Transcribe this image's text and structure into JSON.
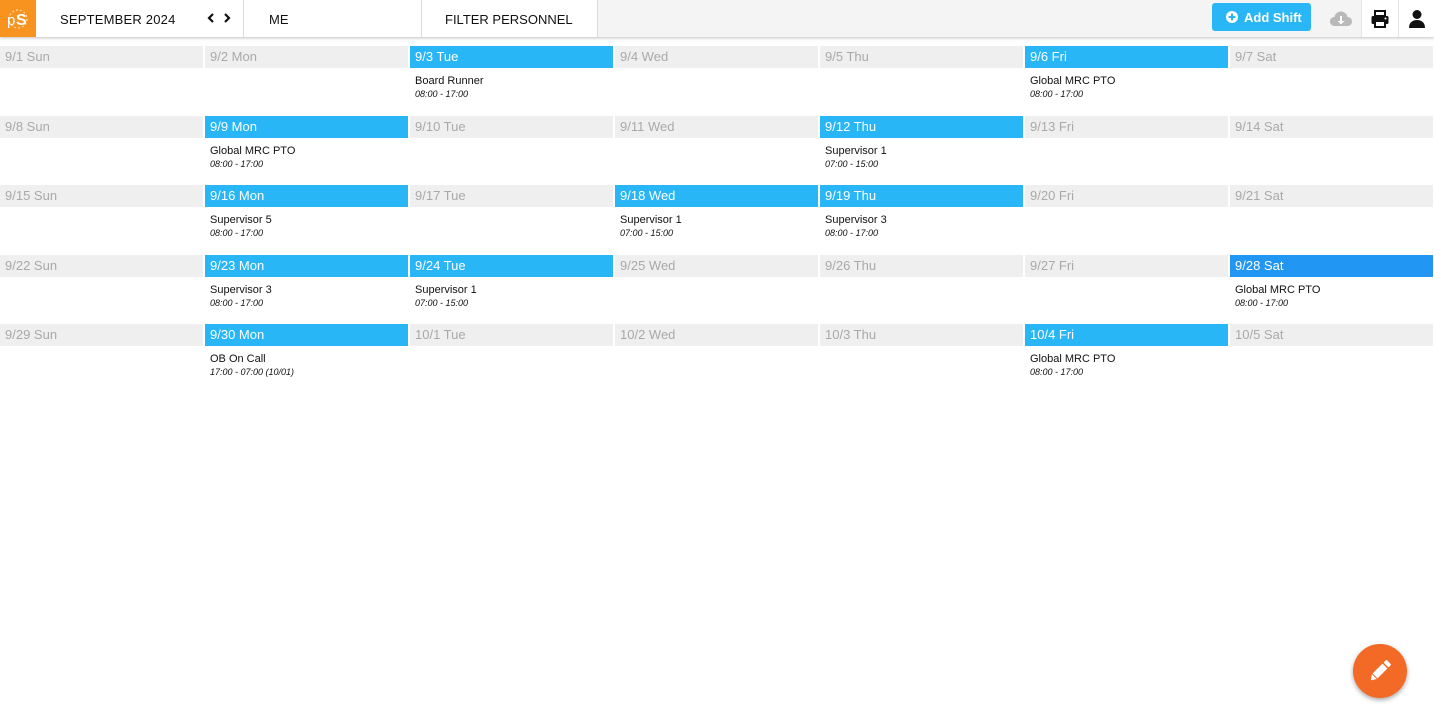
{
  "header": {
    "logo_text": "pS",
    "month_label": "SEPTEMBER 2024",
    "me_label": "ME",
    "filter_label": "FILTER PERSONNEL",
    "add_shift_label": "Add Shift",
    "icons": {
      "prev": "chevron-left-icon",
      "next": "chevron-right-icon",
      "add": "plus-circle-icon",
      "cloud": "cloud-download-icon",
      "print": "printer-icon",
      "user": "user-icon",
      "edit": "pencil-icon"
    }
  },
  "colors": {
    "brand_orange": "#f7931e",
    "accent_blue": "#29b6f6",
    "today_blue": "#2196f3",
    "fab_orange": "#f26a26",
    "inactive_header": "#efefef"
  },
  "weeks": [
    {
      "days": [
        {
          "label": "9/1 Sun",
          "shift": null
        },
        {
          "label": "9/2 Mon",
          "shift": null
        },
        {
          "label": "9/3 Tue",
          "shift": {
            "name": "Board Runner",
            "time": "08:00 - 17:00"
          }
        },
        {
          "label": "9/4 Wed",
          "shift": null
        },
        {
          "label": "9/5 Thu",
          "shift": null
        },
        {
          "label": "9/6 Fri",
          "shift": {
            "name": "Global MRC PTO",
            "time": "08:00 - 17:00"
          }
        },
        {
          "label": "9/7 Sat",
          "shift": null
        }
      ]
    },
    {
      "days": [
        {
          "label": "9/8 Sun",
          "shift": null
        },
        {
          "label": "9/9 Mon",
          "shift": {
            "name": "Global MRC PTO",
            "time": "08:00 - 17:00"
          }
        },
        {
          "label": "9/10 Tue",
          "shift": null
        },
        {
          "label": "9/11 Wed",
          "shift": null
        },
        {
          "label": "9/12 Thu",
          "shift": {
            "name": "Supervisor 1",
            "time": "07:00 - 15:00"
          }
        },
        {
          "label": "9/13 Fri",
          "shift": null
        },
        {
          "label": "9/14 Sat",
          "shift": null
        }
      ]
    },
    {
      "days": [
        {
          "label": "9/15 Sun",
          "shift": null
        },
        {
          "label": "9/16 Mon",
          "shift": {
            "name": "Supervisor 5",
            "time": "08:00 - 17:00"
          }
        },
        {
          "label": "9/17 Tue",
          "shift": null
        },
        {
          "label": "9/18 Wed",
          "shift": {
            "name": "Supervisor 1",
            "time": "07:00 - 15:00"
          }
        },
        {
          "label": "9/19 Thu",
          "shift": {
            "name": "Supervisor 3",
            "time": "08:00 - 17:00"
          }
        },
        {
          "label": "9/20 Fri",
          "shift": null
        },
        {
          "label": "9/21 Sat",
          "shift": null
        }
      ]
    },
    {
      "days": [
        {
          "label": "9/22 Sun",
          "shift": null
        },
        {
          "label": "9/23 Mon",
          "shift": {
            "name": "Supervisor 3",
            "time": "08:00 - 17:00"
          }
        },
        {
          "label": "9/24 Tue",
          "shift": {
            "name": "Supervisor 1",
            "time": "07:00 - 15:00"
          }
        },
        {
          "label": "9/25 Wed",
          "shift": null
        },
        {
          "label": "9/26 Thu",
          "shift": null
        },
        {
          "label": "9/27 Fri",
          "shift": null
        },
        {
          "label": "9/28 Sat",
          "shift": {
            "name": "Global MRC PTO",
            "time": "08:00 - 17:00"
          },
          "today": true
        }
      ]
    },
    {
      "days": [
        {
          "label": "9/29 Sun",
          "shift": null
        },
        {
          "label": "9/30 Mon",
          "shift": {
            "name": "OB On Call",
            "time": "17:00 - 07:00 (10/01)"
          }
        },
        {
          "label": "10/1 Tue",
          "shift": null
        },
        {
          "label": "10/2 Wed",
          "shift": null
        },
        {
          "label": "10/3 Thu",
          "shift": null
        },
        {
          "label": "10/4 Fri",
          "shift": {
            "name": "Global MRC PTO",
            "time": "08:00 - 17:00"
          }
        },
        {
          "label": "10/5 Sat",
          "shift": null
        }
      ]
    }
  ]
}
